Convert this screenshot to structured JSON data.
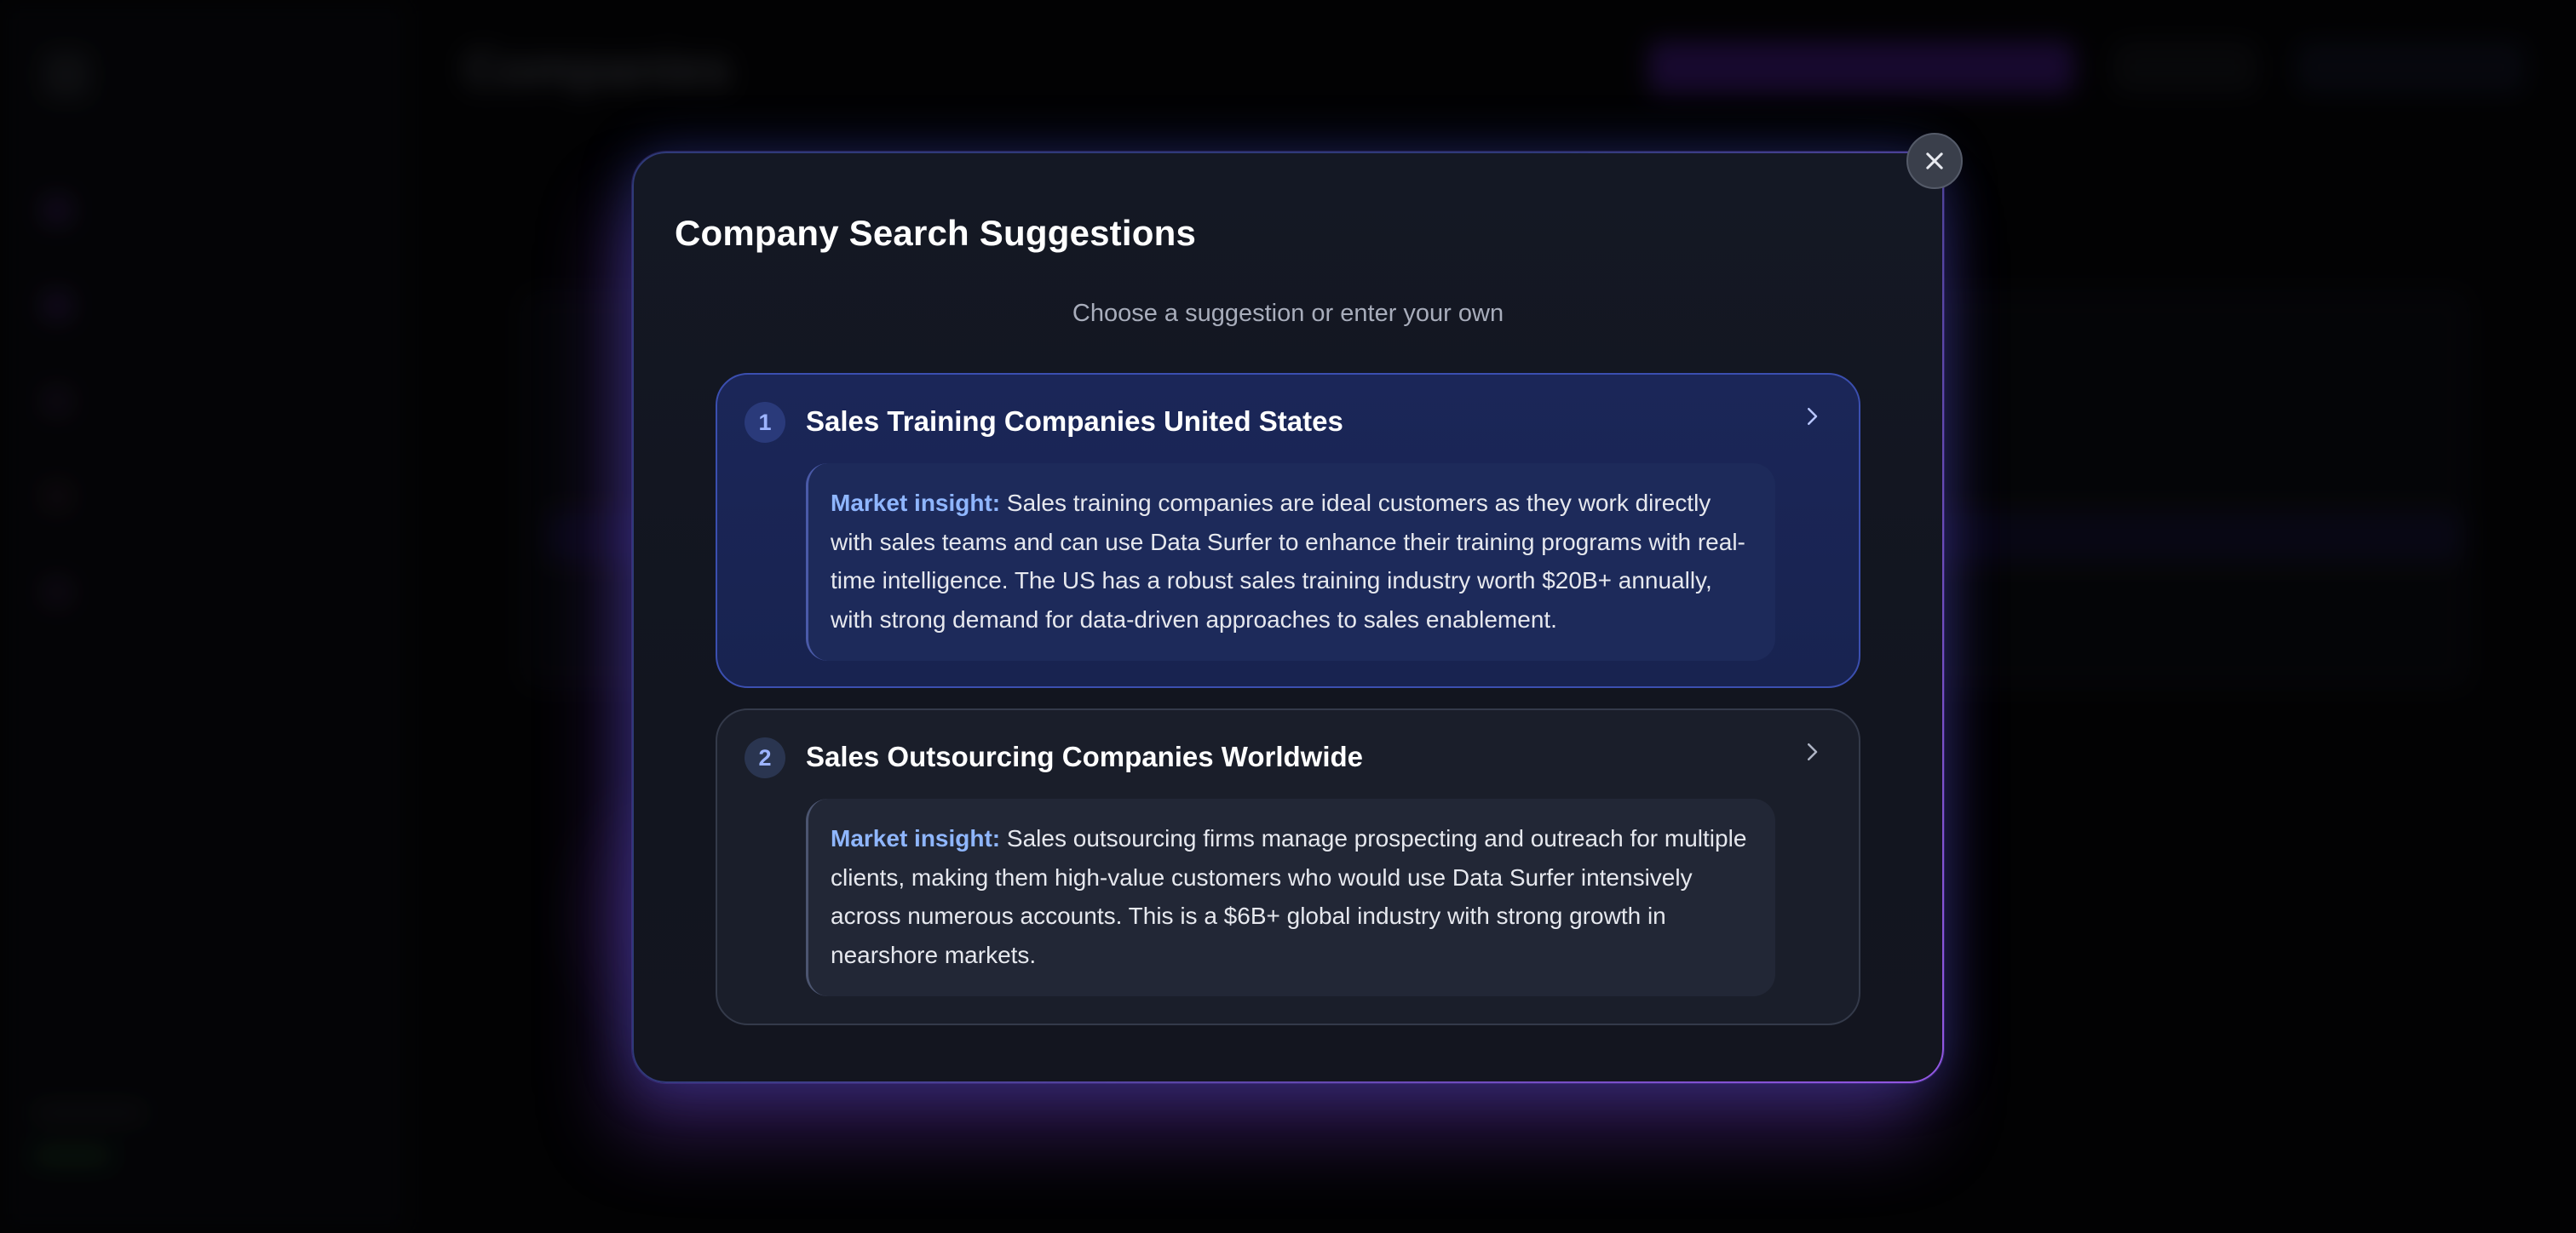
{
  "background": {
    "app_title": "Companies",
    "nav_items": [
      "",
      "",
      "",
      "",
      ""
    ]
  },
  "modal": {
    "title": "Company Search Suggestions",
    "subtitle": "Choose a suggestion or enter your own",
    "close_icon": "close-icon",
    "suggestions": [
      {
        "number": "1",
        "title": "Sales Training Companies United States",
        "insight_label": "Market insight:",
        "insight_text": " Sales training companies are ideal customers as they work directly with sales teams and can use Data Surfer to enhance their training programs with real-time intelligence. The US has a robust sales training industry worth $20B+ annually, with strong demand for data-driven approaches to sales enablement."
      },
      {
        "number": "2",
        "title": "Sales Outsourcing Companies Worldwide",
        "insight_label": "Market insight:",
        "insight_text": " Sales outsourcing firms manage prospecting and outreach for multiple clients, making them high-value customers who would use Data Surfer intensively across numerous accounts. This is a $6B+ global industry with strong growth in nearshore markets."
      }
    ]
  },
  "colors": {
    "accent_blue": "#3b4fb0",
    "accent_purple": "#a05af0",
    "insight_label": "#8fb6ff"
  }
}
